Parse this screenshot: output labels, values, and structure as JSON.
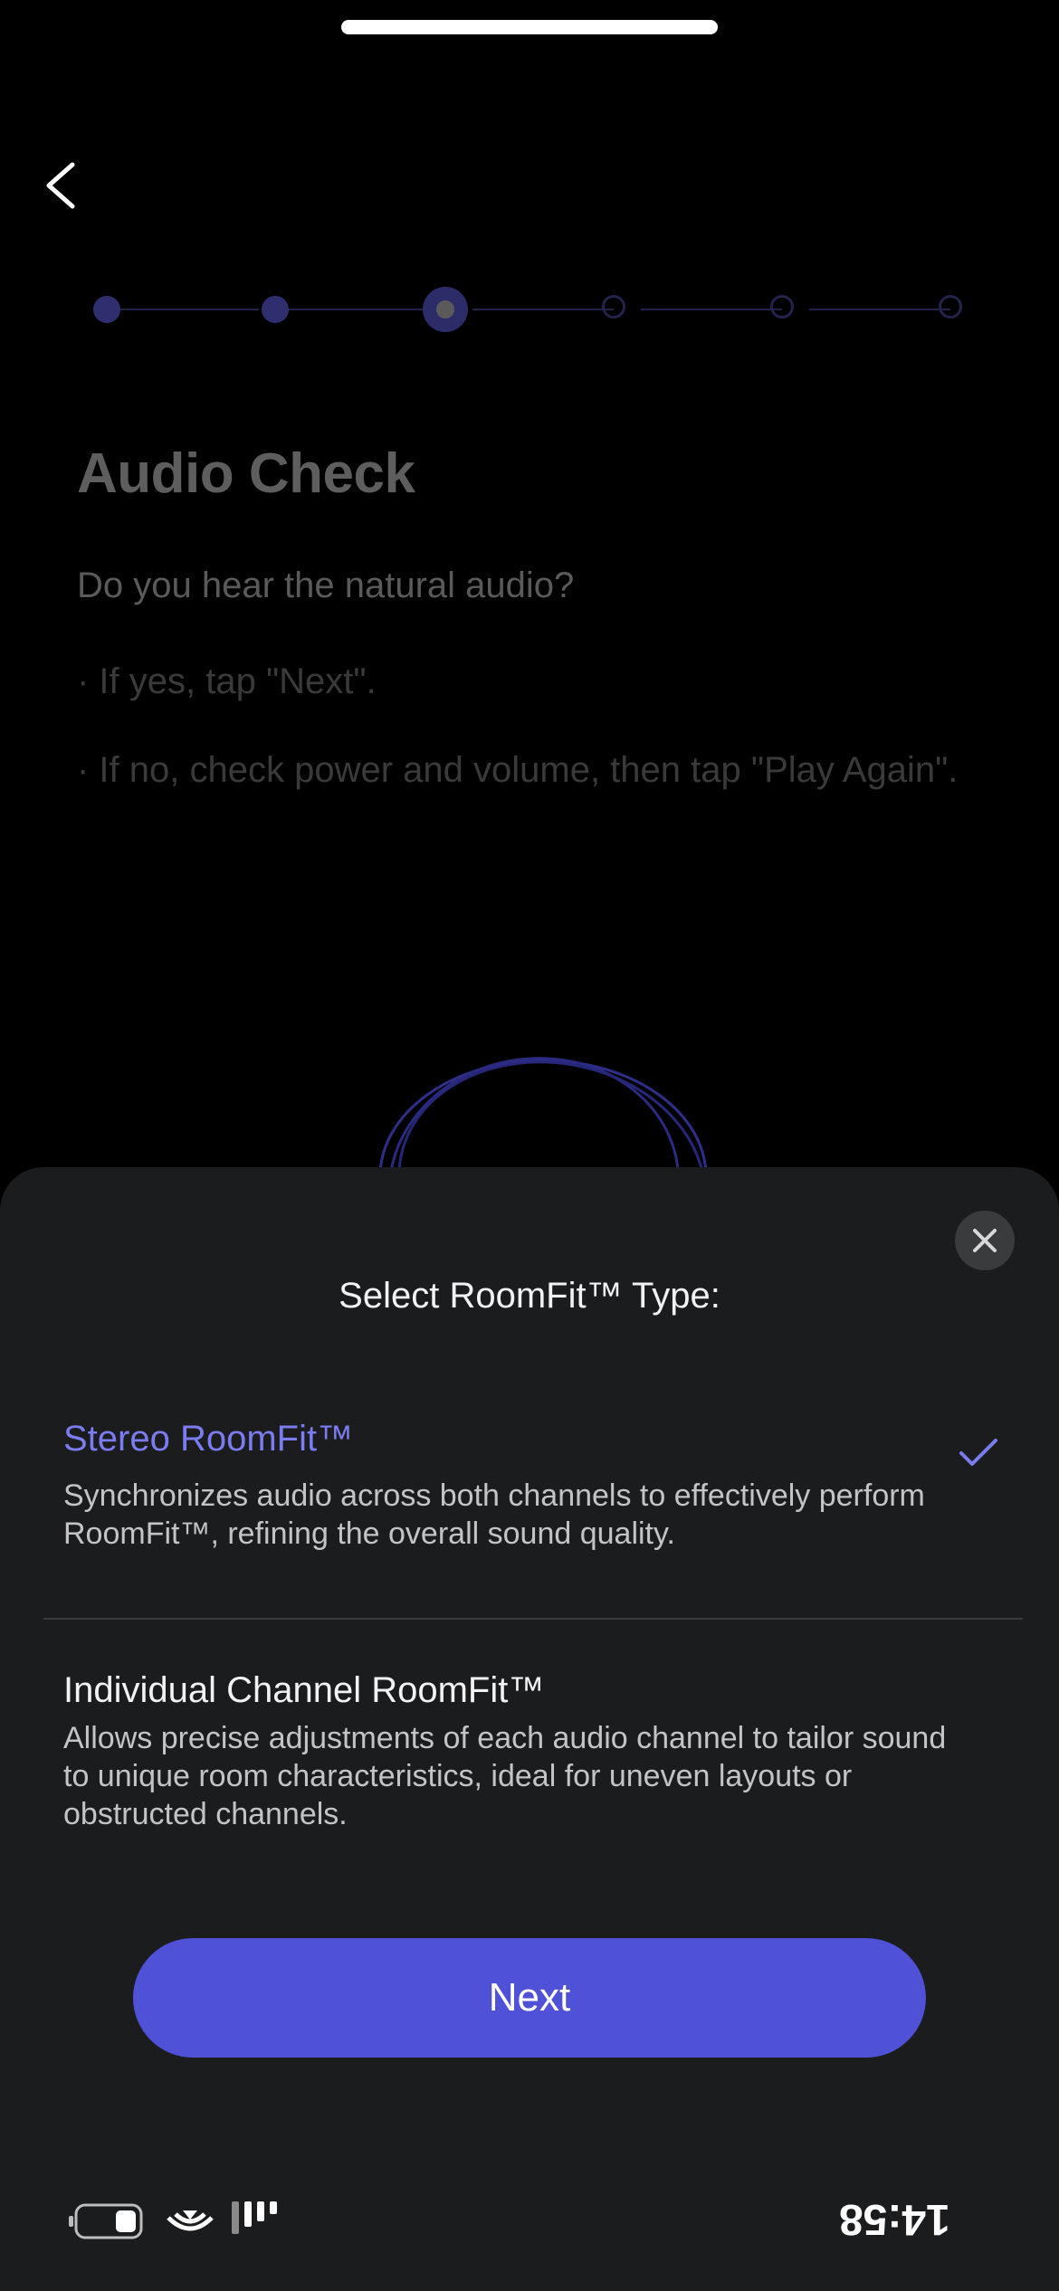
{
  "background": {
    "audio_check": {
      "title": "Audio Check",
      "question": "Do you hear the natural audio?",
      "bullets": [
        "· If yes, tap \"Next\".",
        "· If no, check power and volume, then tap \"Play Again\"."
      ]
    }
  },
  "stepper": {
    "total_steps": 6,
    "current_step": 3
  },
  "sheet": {
    "title": "Select RoomFit™ Type:",
    "options": [
      {
        "title": "Stereo RoomFit™",
        "description": "Synchronizes audio across both channels to effectively perform RoomFit™, refining the overall sound quality.",
        "selected": true
      },
      {
        "title": "Individual Channel RoomFit™",
        "description": "Allows precise adjustments of each audio channel to tailor sound to unique room characteristics, ideal for uneven layouts or obstructed channels.",
        "selected": false
      }
    ],
    "next_label": "Next"
  },
  "status_bar": {
    "time": "14:58"
  },
  "colors": {
    "accent": "#4f52d6",
    "selected_text": "#7b7cf0",
    "sheet_bg": "#1b1c1e"
  },
  "icons": [
    "back-icon",
    "close-icon",
    "checkmark-icon",
    "battery-icon",
    "wifi-icon",
    "signal-icon"
  ]
}
